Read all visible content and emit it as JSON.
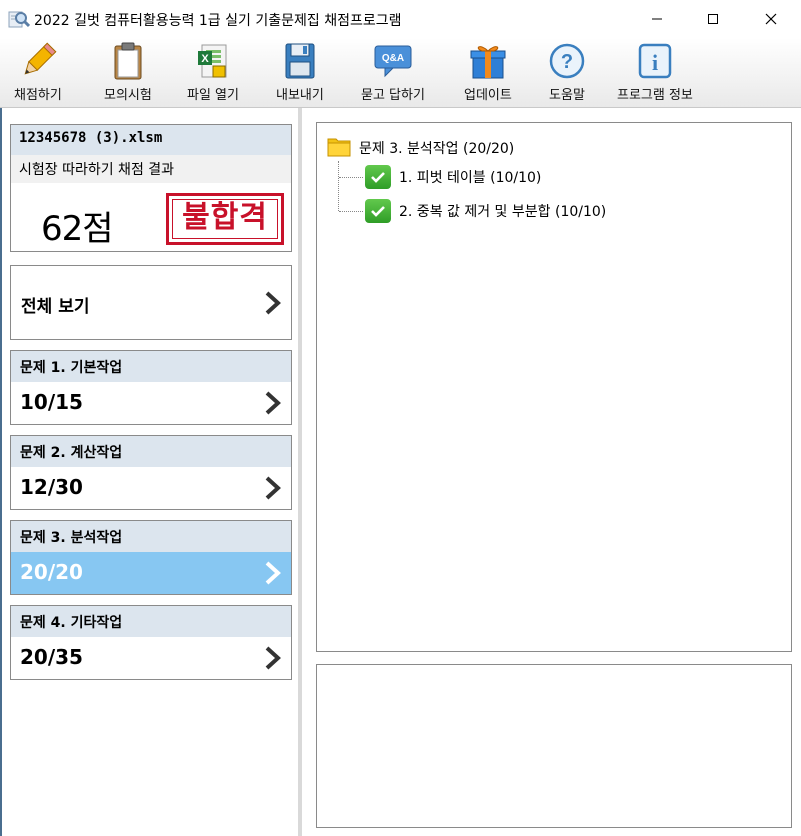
{
  "window": {
    "title": "2022 길벗 컴퓨터활용능력 1급 실기 기출문제집 채점프로그램"
  },
  "toolbar": {
    "items": [
      {
        "label": "채점하기",
        "icon": "pencil-icon"
      },
      {
        "label": "모의시험",
        "icon": "clipboard-icon"
      },
      {
        "label": "파일 열기",
        "icon": "excel-file-icon"
      },
      {
        "label": "내보내기",
        "icon": "floppy-disk-icon"
      },
      {
        "label": "묻고 답하기",
        "icon": "qa-bubble-icon",
        "icon_text": "Q&A"
      },
      {
        "label": "업데이트",
        "icon": "gift-box-icon"
      },
      {
        "label": "도움말",
        "icon": "help-icon",
        "icon_text": "?"
      },
      {
        "label": "프로그램 정보",
        "icon": "info-icon",
        "icon_text": "i"
      }
    ]
  },
  "result": {
    "file_name": "12345678 (3).xlsm",
    "subtitle": "시험장 따라하기 채점 결과",
    "score": "62점",
    "stamp": "불합격",
    "stamp_color": "#c8112a"
  },
  "sections": {
    "all_label": "전체 보기",
    "items": [
      {
        "title": "문제 1. 기본작업",
        "score": "10/15",
        "active": false
      },
      {
        "title": "문제 2. 계산작업",
        "score": "12/30",
        "active": false
      },
      {
        "title": "문제 3. 분석작업",
        "score": "20/20",
        "active": true
      },
      {
        "title": "문제 4. 기타작업",
        "score": "20/35",
        "active": false
      }
    ],
    "active_color": "#87c7f2"
  },
  "tree": {
    "root": "문제 3. 분석작업 (20/20)",
    "children": [
      "1. 피벗 테이블 (10/10)",
      "2. 중복 값 제거 및 부분합 (10/10)"
    ]
  }
}
